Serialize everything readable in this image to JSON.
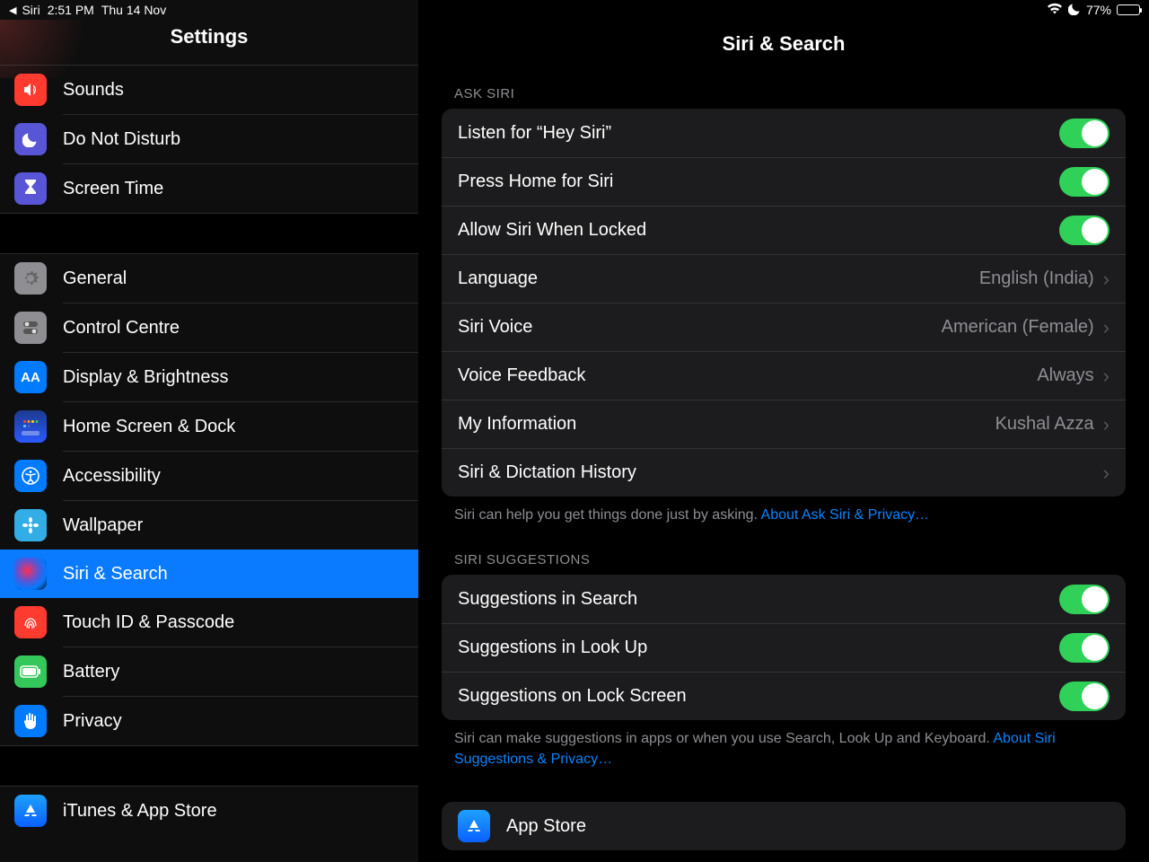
{
  "statusbar": {
    "back_app": "Siri",
    "time": "2:51 PM",
    "date": "Thu 14 Nov",
    "battery_pct": "77%"
  },
  "sidebar": {
    "title": "Settings",
    "group1": [
      {
        "label": "Sounds"
      },
      {
        "label": "Do Not Disturb"
      },
      {
        "label": "Screen Time"
      }
    ],
    "group2": [
      {
        "label": "General"
      },
      {
        "label": "Control Centre"
      },
      {
        "label": "Display & Brightness"
      },
      {
        "label": "Home Screen & Dock"
      },
      {
        "label": "Accessibility"
      },
      {
        "label": "Wallpaper"
      },
      {
        "label": "Siri & Search"
      },
      {
        "label": "Touch ID & Passcode"
      },
      {
        "label": "Battery"
      },
      {
        "label": "Privacy"
      }
    ],
    "group3": [
      {
        "label": "iTunes & App Store"
      }
    ]
  },
  "main": {
    "title": "Siri & Search",
    "section1_header": "ASK SIRI",
    "rows1": {
      "hey_siri": "Listen for “Hey Siri”",
      "press_home": "Press Home for Siri",
      "when_locked": "Allow Siri When Locked",
      "language": "Language",
      "language_val": "English (India)",
      "voice": "Siri Voice",
      "voice_val": "American (Female)",
      "feedback": "Voice Feedback",
      "feedback_val": "Always",
      "myinfo": "My Information",
      "myinfo_val": "Kushal Azza",
      "history": "Siri & Dictation History"
    },
    "footer1_text": "Siri can help you get things done just by asking.",
    "footer1_link": "About Ask Siri & Privacy…",
    "section2_header": "SIRI SUGGESTIONS",
    "rows2": {
      "s_search": "Suggestions in Search",
      "s_lookup": "Suggestions in Look Up",
      "s_lock": "Suggestions on Lock Screen"
    },
    "footer2_text": "Siri can make suggestions in apps or when you use Search, Look Up and Keyboard.",
    "footer2_link": "About Siri Suggestions & Privacy…",
    "appstore_label": "App Store"
  }
}
